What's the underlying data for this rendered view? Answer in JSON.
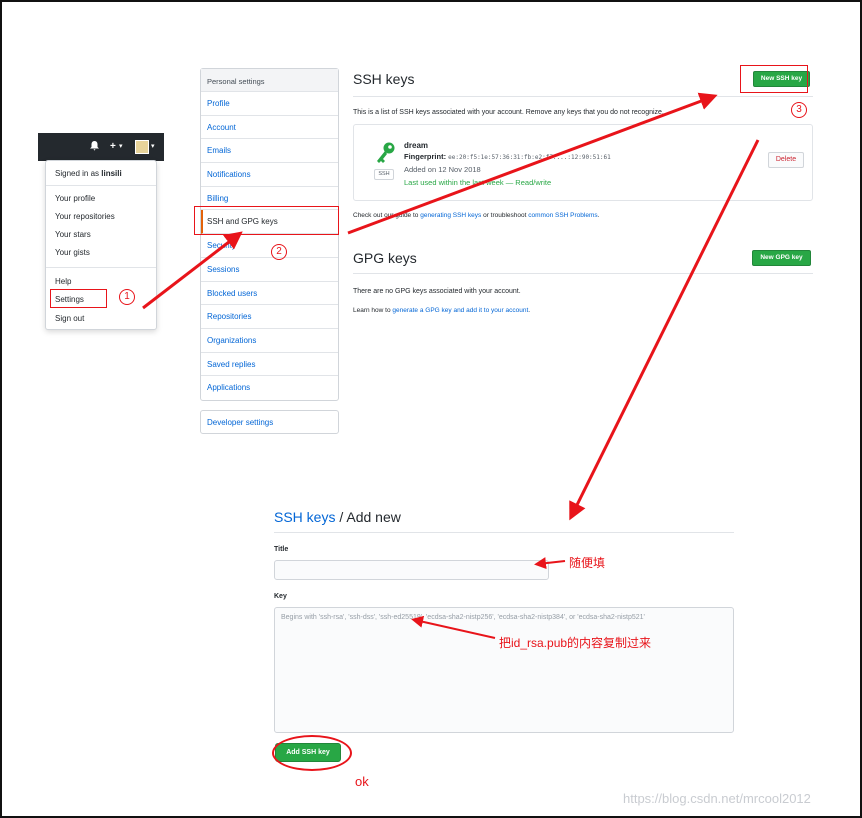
{
  "header": {
    "bell_icon": "bell-icon",
    "plus_glyph": "+",
    "caret_glyph": "▾"
  },
  "dropdown": {
    "signed_in_prefix": "Signed in as ",
    "username": "linsili",
    "items": [
      "Your profile",
      "Your repositories",
      "Your stars",
      "Your gists"
    ],
    "help": "Help",
    "settings": "Settings",
    "sign_out": "Sign out"
  },
  "sidebar": {
    "heading": "Personal settings",
    "items": [
      "Profile",
      "Account",
      "Emails",
      "Notifications",
      "Billing",
      "SSH and GPG keys",
      "Security",
      "Sessions",
      "Blocked users",
      "Repositories",
      "Organizations",
      "Saved replies",
      "Applications"
    ],
    "selected": "SSH and GPG keys",
    "developer": "Developer settings"
  },
  "ssh": {
    "title": "SSH keys",
    "new_button": "New SSH key",
    "description": "This is a list of SSH keys associated with your account. Remove any keys that you do not recognize.",
    "key": {
      "name": "dream",
      "fingerprint_label": "Fingerprint:",
      "fingerprint": "ee:20:f5:1e:57:36:31:fb:e2:f7:...:12:90:51:61",
      "added": "Added on 12 Nov 2018",
      "last_used": "Last used within the last week — Read/write",
      "badge": "SSH",
      "delete": "Delete"
    },
    "footer_prefix": "Check out our guide to ",
    "footer_link1": "generating SSH keys",
    "footer_mid": " or troubleshoot ",
    "footer_link2": "common SSH Problems",
    "footer_end": "."
  },
  "gpg": {
    "title": "GPG keys",
    "new_button": "New GPG key",
    "empty": "There are no GPG keys associated with your account.",
    "learn_prefix": "Learn how to ",
    "learn_link": "generate a GPG key and add it to your account",
    "learn_end": "."
  },
  "form": {
    "crumb": "SSH keys",
    "title_rest": " / Add new",
    "title_label": "Title",
    "key_label": "Key",
    "key_placeholder": "Begins with 'ssh-rsa', 'ssh-dss', 'ssh-ed25519', 'ecdsa-sha2-nistp256', 'ecdsa-sha2-nistp384', or 'ecdsa-sha2-nistp521'",
    "submit": "Add SSH key"
  },
  "annotations": {
    "step1": "1",
    "step2": "2",
    "step3": "3",
    "title_note": "随便填",
    "key_note": "把id_rsa.pub的内容复制过来",
    "ok": "ok",
    "color": "#e8141a"
  },
  "watermark": "https://blog.csdn.net/mrcool2012"
}
